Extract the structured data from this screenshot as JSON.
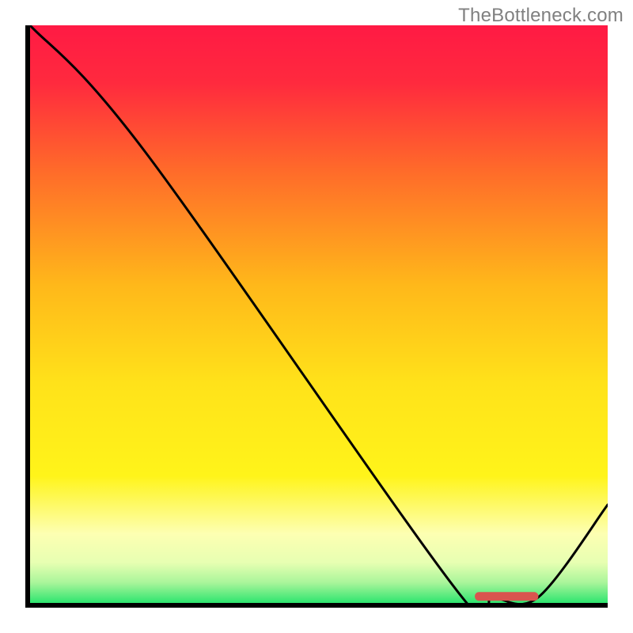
{
  "watermark": "TheBottleneck.com",
  "colors": {
    "gradient_stops": [
      {
        "offset": 0.0,
        "color": "#ff1a44"
      },
      {
        "offset": 0.1,
        "color": "#ff2a3e"
      },
      {
        "offset": 0.25,
        "color": "#ff6a2a"
      },
      {
        "offset": 0.45,
        "color": "#ffb81a"
      },
      {
        "offset": 0.62,
        "color": "#ffe21a"
      },
      {
        "offset": 0.78,
        "color": "#fff41a"
      },
      {
        "offset": 0.88,
        "color": "#fdffb2"
      },
      {
        "offset": 0.93,
        "color": "#e7ffb2"
      },
      {
        "offset": 0.965,
        "color": "#a9f59a"
      },
      {
        "offset": 1.0,
        "color": "#2ee56f"
      }
    ],
    "curve": "#000000",
    "marker": "#d9544f",
    "axis": "#000000"
  },
  "chart_data": {
    "type": "line",
    "title": "",
    "xlabel": "",
    "ylabel": "",
    "xlim": [
      0,
      100
    ],
    "ylim": [
      0,
      100
    ],
    "grid": false,
    "legend_position": "none",
    "series": [
      {
        "name": "bottleneck-curve",
        "x": [
          0,
          20,
          74,
          80,
          88,
          100
        ],
        "y": [
          100,
          78,
          2,
          1,
          1,
          17
        ]
      }
    ],
    "optimal_marker": {
      "x_start": 77,
      "x_end": 88,
      "y": 1.2
    },
    "annotations": []
  }
}
